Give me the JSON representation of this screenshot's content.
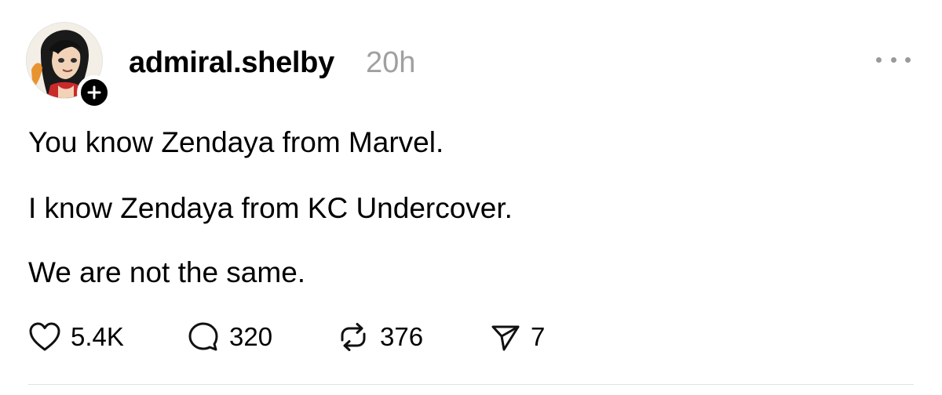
{
  "post": {
    "username": "admiral.shelby",
    "timestamp": "20h",
    "body": [
      "You know Zendaya from Marvel.",
      "I know Zendaya from KC Undercover.",
      "We are not the same."
    ],
    "stats": {
      "likes": "5.4K",
      "replies": "320",
      "reposts": "376",
      "shares": "7"
    }
  },
  "icons": {
    "follow": "plus-icon",
    "more": "more-horizontal-icon",
    "like": "heart-icon",
    "reply": "comment-bubble-icon",
    "repost": "repost-arrows-icon",
    "share": "send-triangle-icon"
  }
}
